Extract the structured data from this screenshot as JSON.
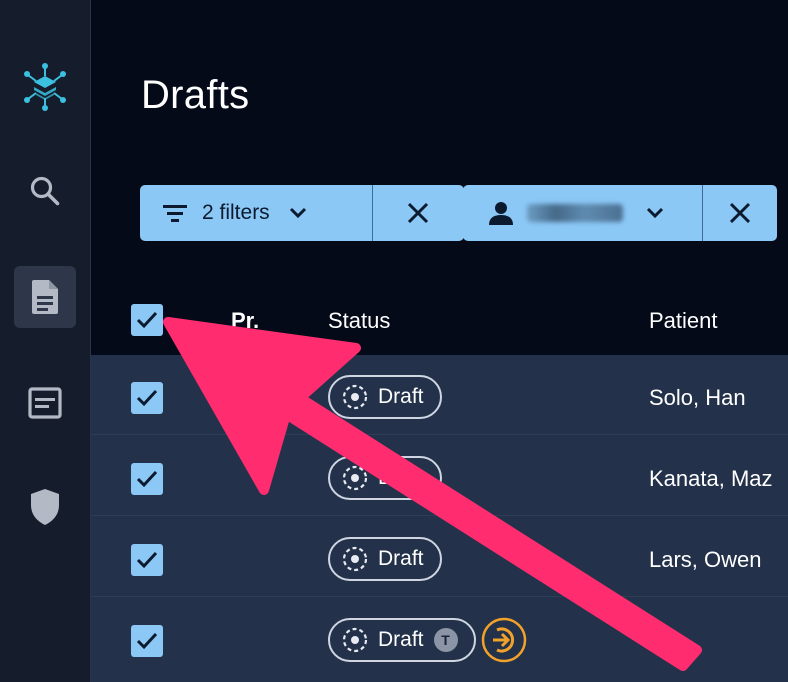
{
  "page": {
    "title": "Drafts"
  },
  "sidebar": {
    "items": [
      {
        "name": "logo",
        "icon": "hexagon-network-logo-icon"
      },
      {
        "name": "search",
        "icon": "search-icon"
      },
      {
        "name": "documents",
        "icon": "document-icon",
        "active": true
      },
      {
        "name": "forms",
        "icon": "form-window-icon"
      },
      {
        "name": "security",
        "icon": "shield-icon"
      }
    ]
  },
  "filters": {
    "filter_chip": {
      "label": "2 filters",
      "icon": "filter-lines-icon"
    },
    "user_chip": {
      "label": "",
      "icon": "person-icon"
    }
  },
  "table": {
    "columns": {
      "priority": "Pr.",
      "status": "Status",
      "patient": "Patient"
    },
    "rows": [
      {
        "status": "Draft",
        "patient": "Solo, Han",
        "badge": ""
      },
      {
        "status": "Draft",
        "patient": "Kanata, Maz",
        "badge": ""
      },
      {
        "status": "Draft",
        "patient": "Lars, Owen",
        "badge": ""
      },
      {
        "status": "Draft",
        "patient": "",
        "badge": "T"
      }
    ]
  },
  "colors": {
    "background": "#050a19",
    "sidebar": "#151d2d",
    "accent": "#8cc8f6",
    "row_bg": "#23324a",
    "annotation_arrow": "#ff2d6f",
    "transfer": "#f0a22a"
  }
}
